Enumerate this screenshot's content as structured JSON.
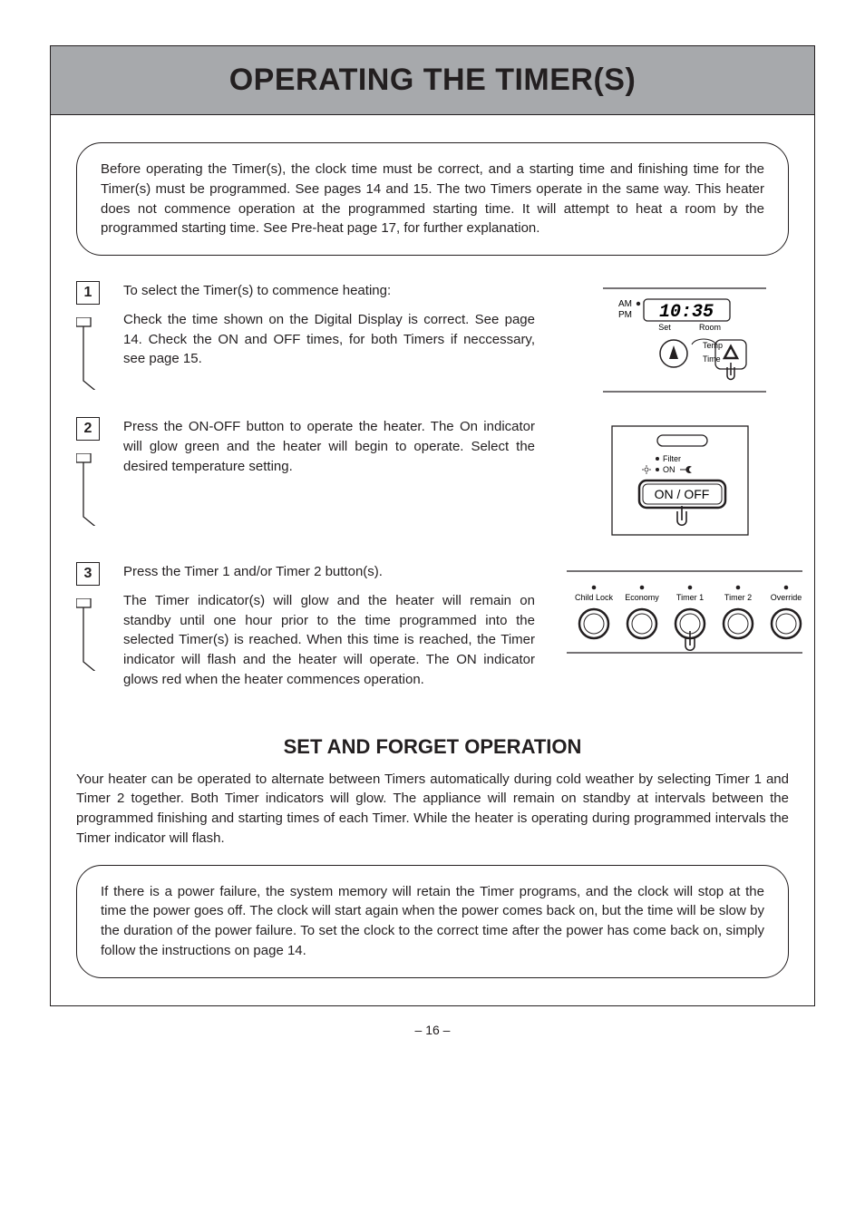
{
  "title": "OPERATING THE TIMER(S)",
  "intro": "Before operating the Timer(s), the clock time must be correct, and a starting time and finishing time for the Timer(s) must be programmed.  See pages 14 and 15.  The two Timers operate in the same way.  This heater does not commence operation at the programmed starting time.  It will attempt to heat a room by the programmed starting time.  See Pre-heat page 17, for further explanation.",
  "steps": {
    "s1": {
      "num": "1",
      "p1": "To select the Timer(s) to commence heating:",
      "p2": "Check the time shown on the Digital Display is correct.  See page 14.  Check the ON and OFF times, for both Timers if neccessary, see page 15."
    },
    "s2": {
      "num": "2",
      "p1": "Press the ON-OFF button to operate the heater.  The On indicator will glow green and the heater will begin to operate.  Select the desired temperature setting."
    },
    "s3": {
      "num": "3",
      "p1": "Press the Timer 1 and/or Timer 2 button(s).",
      "p2": "The Timer indicator(s) will glow and the heater will remain on standby until one hour prior to the time programmed into the selected Timer(s) is reached.  When this time is reached, the Timer indicator will flash and the heater will operate.  The ON indicator glows red when the heater commences operation."
    }
  },
  "saf": {
    "title": "SET AND FORGET OPERATION",
    "text": "Your heater can be operated to alternate between Timers automatically during cold weather by selecting Timer 1 and Timer 2 together.  Both Timer indicators will glow.  The appliance will remain on standby at intervals between the programmed finishing and starting times of each Timer.  While the heater is operating during programmed intervals the Timer indicator will flash.",
    "callout": "If there is a power failure, the system memory will retain the Timer programs, and the clock will stop at the time the power goes off.  The clock will start again when the power comes back on, but the time will be slow by the duration of the power failure.  To set the clock to the correct time after the power has come back on, simply follow the  instructions on page 14."
  },
  "page_number": "– 16 –",
  "fig1": {
    "am": "AM",
    "pm": "PM",
    "time": "10:35",
    "set": "Set",
    "room": "Room",
    "temp": "Temp",
    "time_label": "Time"
  },
  "fig2": {
    "filter": "Filter",
    "on": "ON",
    "onoff": "ON / OFF"
  },
  "fig3": {
    "labels": [
      "Child Lock",
      "Economy",
      "Timer 1",
      "Timer 2",
      "Override"
    ]
  }
}
